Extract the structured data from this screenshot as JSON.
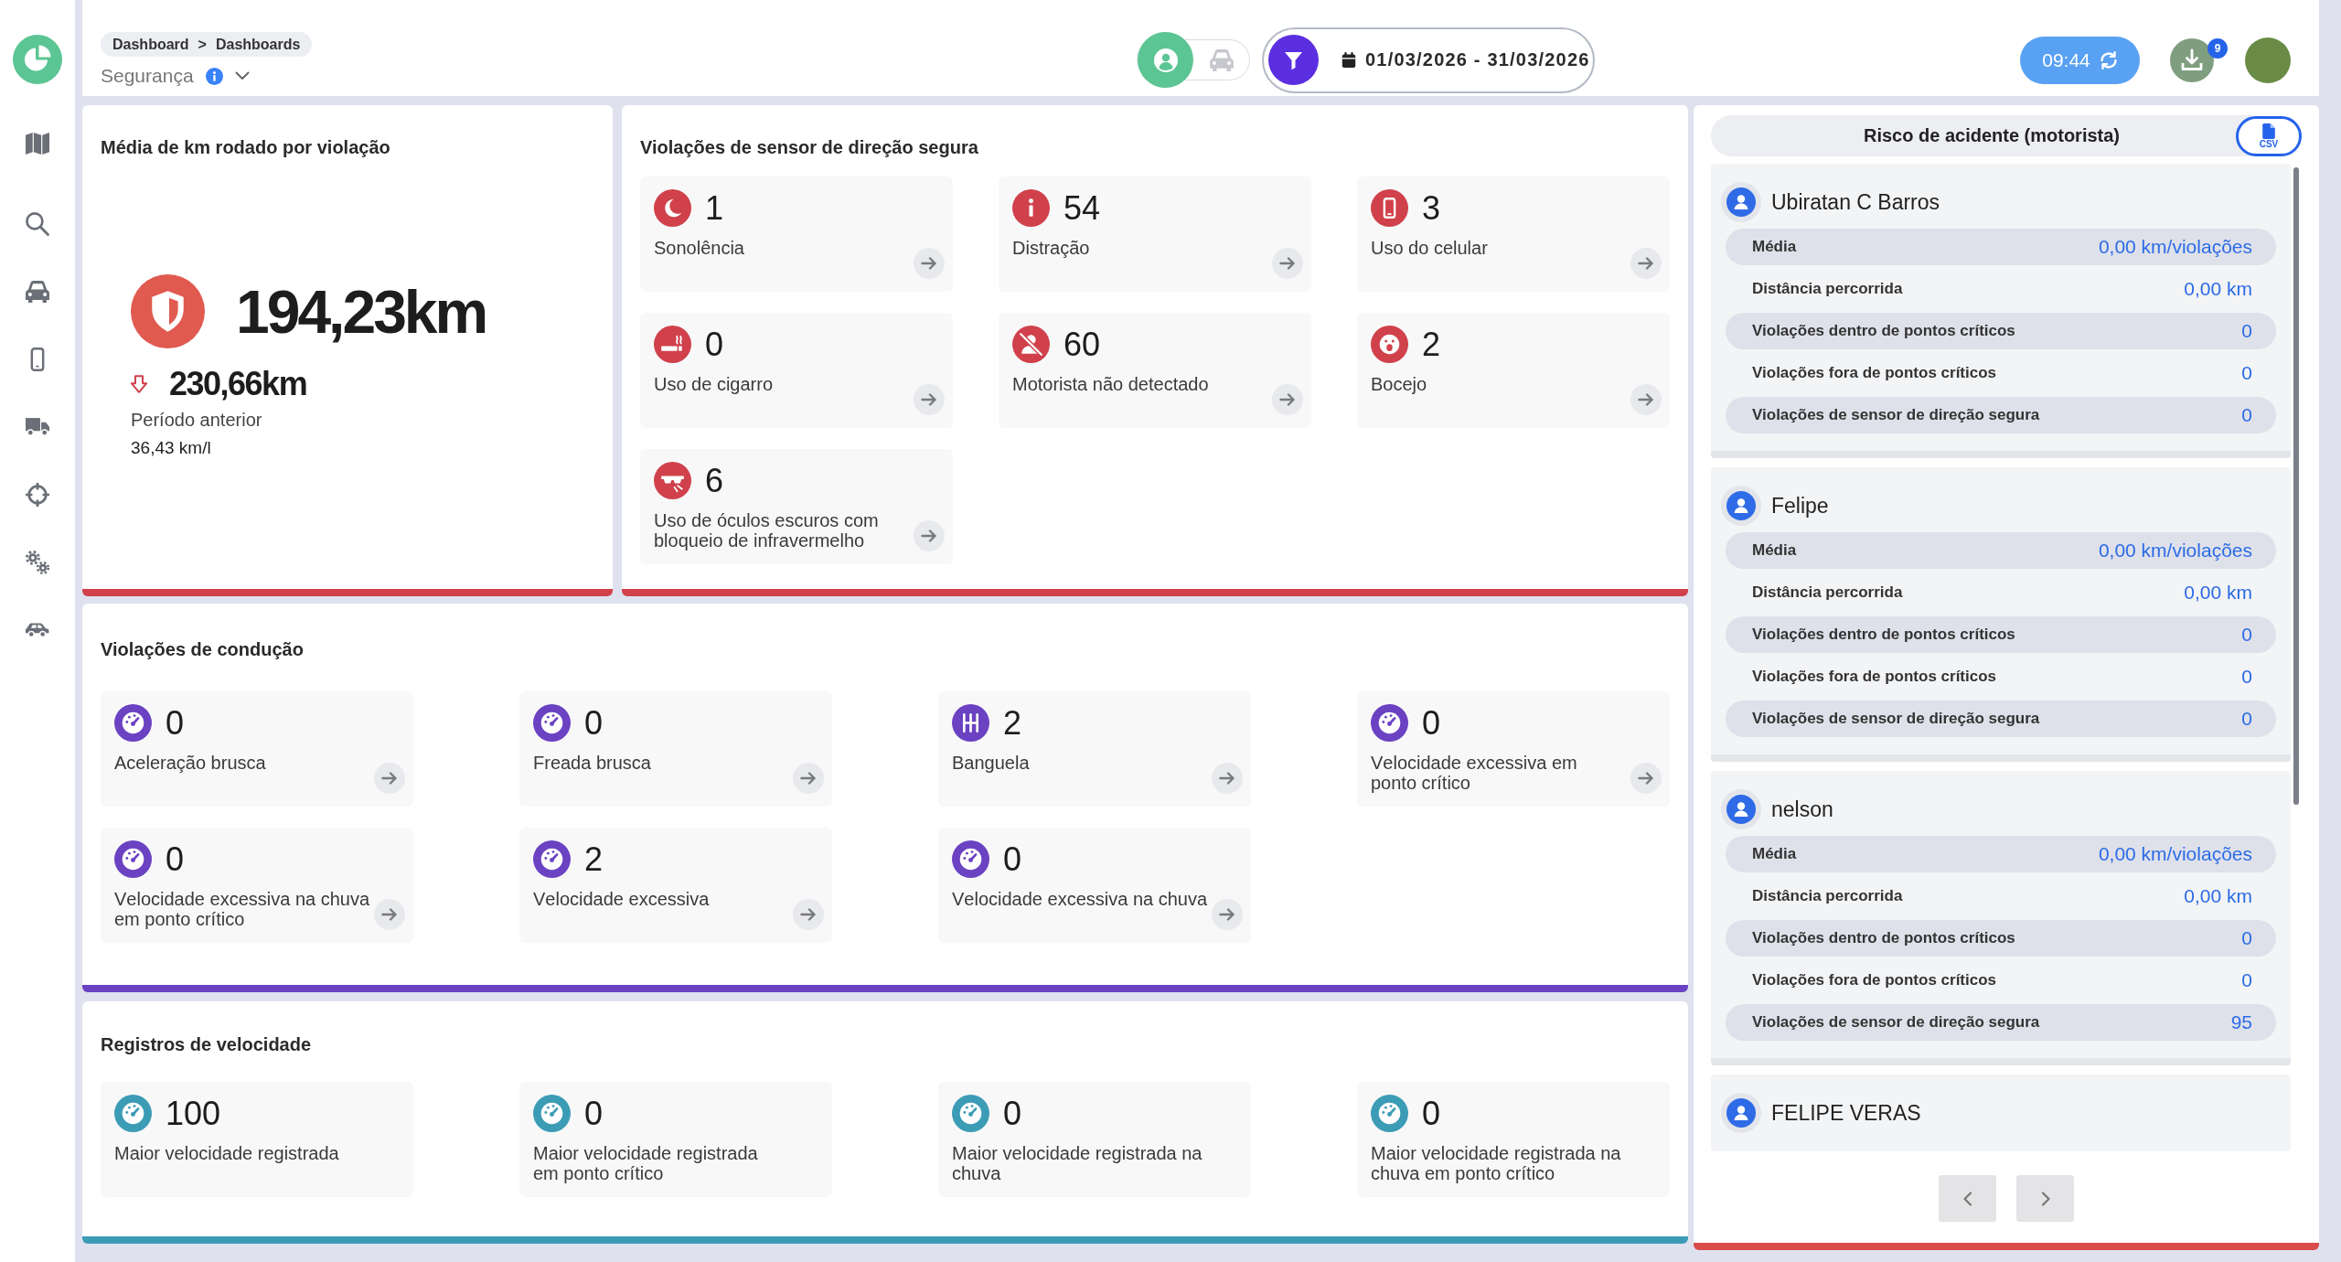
{
  "header": {
    "breadcrumb": {
      "items": [
        "Dashboard",
        "Dashboards"
      ],
      "separator": ">"
    },
    "page_title": "Segurança",
    "view_toggle": [
      {
        "selected": true
      },
      {
        "selected": false
      }
    ],
    "date_range": "01/03/2026 - 31/03/2026",
    "time": "09:44",
    "downloads_badge": "9"
  },
  "km_per_violation": {
    "title": "Média de km rodado por violação",
    "value": "194,23km",
    "decreased": true,
    "previous_value": "230,66km",
    "previous_label": "Período anterior",
    "consumption": "36,43 km/l"
  },
  "sensor_violations": {
    "title": "Violações de sensor de direção segura",
    "items": [
      {
        "count": "1",
        "label": "Sonolência"
      },
      {
        "count": "54",
        "label": "Distração"
      },
      {
        "count": "3",
        "label": "Uso do celular"
      },
      {
        "count": "0",
        "label": "Uso de cigarro"
      },
      {
        "count": "60",
        "label": "Motorista não detectado"
      },
      {
        "count": "2",
        "label": "Bocejo"
      },
      {
        "count": "6",
        "label": "Uso de óculos escuros com bloqueio de infravermelho"
      }
    ]
  },
  "driving_violations": {
    "title": "Violações de condução",
    "items": [
      {
        "count": "0",
        "label": "Aceleração brusca"
      },
      {
        "count": "0",
        "label": "Freada brusca"
      },
      {
        "count": "2",
        "label": "Banguela"
      },
      {
        "count": "0",
        "label": "Velocidade excessiva em ponto crítico"
      },
      {
        "count": "0",
        "label": "Velocidade excessiva na chuva em ponto crítico"
      },
      {
        "count": "2",
        "label": "Velocidade excessiva"
      },
      {
        "count": "0",
        "label": "Velocidade excessiva na chuva"
      }
    ]
  },
  "speed_records": {
    "title": "Registros de velocidade",
    "items": [
      {
        "count": "100",
        "label": "Maior velocidade registrada"
      },
      {
        "count": "0",
        "label": "Maior velocidade registrada em ponto crítico"
      },
      {
        "count": "0",
        "label": "Maior velocidade registrada na chuva"
      },
      {
        "count": "0",
        "label": "Maior velocidade registrada na chuva em ponto crítico"
      }
    ]
  },
  "accident_risk": {
    "title": "Risco de acidente (motorista)",
    "export_label": "CSV",
    "drivers": [
      {
        "name": "Ubiratan C Barros",
        "stats": [
          {
            "label": "Média",
            "value": "0,00 km/violações"
          },
          {
            "label": "Distância percorrida",
            "value": "0,00 km"
          },
          {
            "label": "Violações dentro de pontos críticos",
            "value": "0"
          },
          {
            "label": "Violações fora de pontos críticos",
            "value": "0"
          },
          {
            "label": "Violações de sensor de direção segura",
            "value": "0"
          }
        ]
      },
      {
        "name": "Felipe",
        "stats": [
          {
            "label": "Média",
            "value": "0,00 km/violações"
          },
          {
            "label": "Distância percorrida",
            "value": "0,00 km"
          },
          {
            "label": "Violações dentro de pontos críticos",
            "value": "0"
          },
          {
            "label": "Violações fora de pontos críticos",
            "value": "0"
          },
          {
            "label": "Violações de sensor de direção segura",
            "value": "0"
          }
        ]
      },
      {
        "name": "nelson",
        "stats": [
          {
            "label": "Média",
            "value": "0,00 km/violações"
          },
          {
            "label": "Distância percorrida",
            "value": "0,00 km"
          },
          {
            "label": "Violações dentro de pontos críticos",
            "value": "0"
          },
          {
            "label": "Violações fora de pontos críticos",
            "value": "0"
          },
          {
            "label": "Violações de sensor de direção segura",
            "value": "95"
          }
        ]
      },
      {
        "name": "FELIPE VERAS"
      }
    ]
  }
}
